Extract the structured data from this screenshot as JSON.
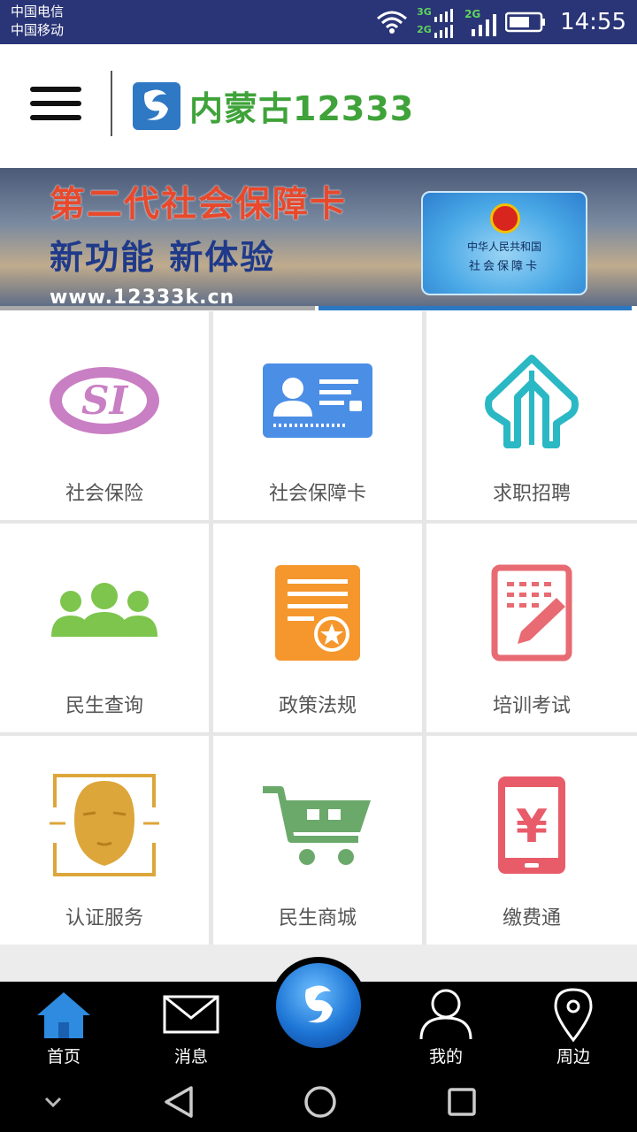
{
  "status_bar": {
    "carrier_1": "中国电信",
    "carrier_2": "中国移动",
    "net_1": "3G",
    "net_2": "2G",
    "net_3": "2G",
    "time": "14:55"
  },
  "header": {
    "logo_text": "内蒙古12333"
  },
  "banner": {
    "title": "第二代社会保障卡",
    "subtitle": "新功能 新体验",
    "url": "www.12333k.cn",
    "card_line_1": "中华人民共和国",
    "card_line_2": "社会保障卡"
  },
  "services": [
    {
      "label": "社会保险",
      "icon": "si-logo-icon",
      "color": "#c97fc3"
    },
    {
      "label": "社会保障卡",
      "icon": "id-card-icon",
      "color": "#4b8ee6"
    },
    {
      "label": "求职招聘",
      "icon": "arrows-up-icon",
      "color": "#2ab8c4"
    },
    {
      "label": "民生查询",
      "icon": "people-group-icon",
      "color": "#7dc54d"
    },
    {
      "label": "政策法规",
      "icon": "policy-doc-icon",
      "color": "#f5972c"
    },
    {
      "label": "培训考试",
      "icon": "exam-sheet-icon",
      "color": "#e86a72"
    },
    {
      "label": "认证服务",
      "icon": "face-scan-icon",
      "color": "#dda63a"
    },
    {
      "label": "民生商城",
      "icon": "shopping-cart-icon",
      "color": "#6ba96b"
    },
    {
      "label": "缴费通",
      "icon": "phone-yuan-icon",
      "color": "#e85c6a"
    }
  ],
  "bottom_nav": {
    "home": "首页",
    "messages": "消息",
    "mine": "我的",
    "nearby": "周边"
  },
  "colors": {
    "status_bar": "#2a3577",
    "accent_blue": "#2b78c2",
    "logo_green": "#3fa33a"
  }
}
